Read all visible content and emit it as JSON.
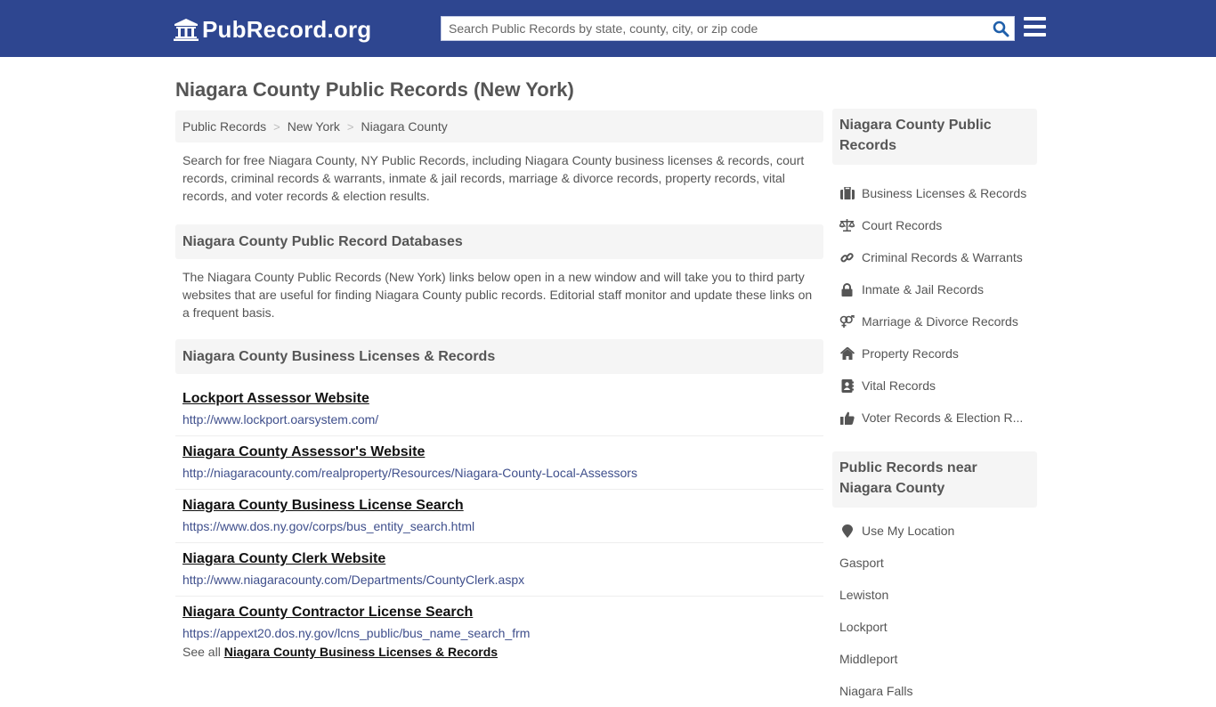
{
  "header": {
    "logo_text": "PubRecord.org",
    "search_placeholder": "Search Public Records by state, county, city, or zip code",
    "search_value": ""
  },
  "page": {
    "title": "Niagara County Public Records (New York)"
  },
  "breadcrumb": [
    {
      "label": "Public Records"
    },
    {
      "label": "New York"
    },
    {
      "label": "Niagara County"
    }
  ],
  "breadcrumb_separator": ">",
  "intro_text": "Search for free Niagara County, NY Public Records, including Niagara County business licenses & records, court records, criminal records & warrants, inmate & jail records, marriage & divorce records, property records, vital records, and voter records & election results.",
  "databases": {
    "heading": "Niagara County Public Record Databases",
    "text": "The Niagara County Public Records (New York) links below open in a new window and will take you to third party websites that are useful for finding Niagara County public records. Editorial staff monitor and update these links on a frequent basis."
  },
  "business": {
    "heading": "Niagara County Business Licenses & Records",
    "links": [
      {
        "title": "Lockport Assessor Website",
        "url": "http://www.lockport.oarsystem.com/"
      },
      {
        "title": "Niagara County Assessor's Website",
        "url": "http://niagaracounty.com/realproperty/Resources/Niagara-County-Local-Assessors"
      },
      {
        "title": "Niagara County Business License Search",
        "url": "https://www.dos.ny.gov/corps/bus_entity_search.html"
      },
      {
        "title": "Niagara County Clerk Website",
        "url": "http://www.niagaracounty.com/Departments/CountyClerk.aspx"
      },
      {
        "title": "Niagara County Contractor License Search",
        "url": "https://appext20.dos.ny.gov/lcns_public/bus_name_search_frm"
      }
    ],
    "see_all_prefix": "See all",
    "see_all_link": "Niagara County Business Licenses & Records"
  },
  "sidebar": {
    "records_heading": "Niagara County Public Records",
    "records": [
      {
        "label": "Business Licenses & Records",
        "icon": "briefcase-icon"
      },
      {
        "label": "Court Records",
        "icon": "balance-scale-icon"
      },
      {
        "label": "Criminal Records & Warrants",
        "icon": "link-icon"
      },
      {
        "label": "Inmate & Jail Records",
        "icon": "lock-icon"
      },
      {
        "label": "Marriage & Divorce Records",
        "icon": "venus-mars-icon"
      },
      {
        "label": "Property Records",
        "icon": "home-icon"
      },
      {
        "label": "Vital Records",
        "icon": "address-book-icon"
      },
      {
        "label": "Voter Records & Election R...",
        "icon": "thumbs-up-icon"
      }
    ],
    "near_heading": "Public Records near Niagara County",
    "use_location": "Use My Location",
    "near_places": [
      "Gasport",
      "Lewiston",
      "Lockport",
      "Middleport",
      "Niagara Falls"
    ]
  },
  "colors": {
    "header_bg": "#2e4690",
    "panel_bg": "#f5f5f5",
    "url_color": "#3f4f8c",
    "search_icon": "#1f5faa"
  }
}
